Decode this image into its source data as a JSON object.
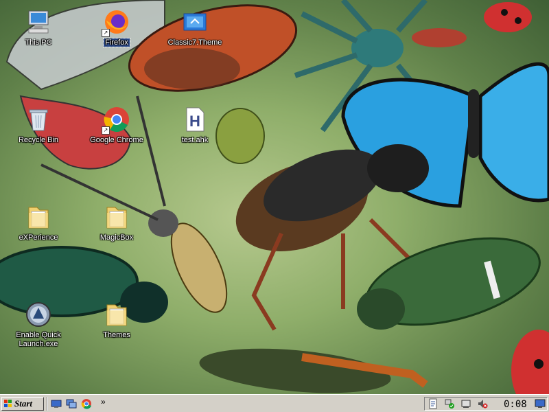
{
  "desktop": {
    "icons": [
      {
        "label": "This PC",
        "icon": "computer-icon"
      },
      {
        "label": "Firefox",
        "icon": "firefox-icon",
        "shortcut": true,
        "selected": true
      },
      {
        "label": "Classic7.Theme",
        "icon": "theme-file-icon"
      },
      {
        "label": "Recycle Bin",
        "icon": "recycle-bin-icon"
      },
      {
        "label": "Google Chrome",
        "icon": "chrome-icon",
        "shortcut": true
      },
      {
        "label": "test.ahk",
        "icon": "ahk-script-icon"
      },
      {
        "label": "eXPerience",
        "icon": "folder-icon"
      },
      {
        "label": "MagicBox",
        "icon": "folder-icon"
      },
      {
        "label": "Enable Quick Launch.exe",
        "icon": "app-icon"
      },
      {
        "label": "Themes",
        "icon": "folder-icon"
      }
    ],
    "wallpaper": "insects"
  },
  "taskbar": {
    "start_label": "Start",
    "chevron": "»",
    "clock": "0:08",
    "quick_launch": [
      "show-desktop-icon",
      "window-switcher-icon",
      "chrome-icon"
    ],
    "tray": [
      "notes-icon",
      "network-icon",
      "safely-remove-icon",
      "volume-muted-icon",
      "display-icon"
    ],
    "colors": {
      "face": "#d4d0c8",
      "flag_red": "#e03010",
      "flag_green": "#20a020",
      "flag_blue": "#1050d0",
      "flag_yellow": "#f0c000"
    }
  }
}
